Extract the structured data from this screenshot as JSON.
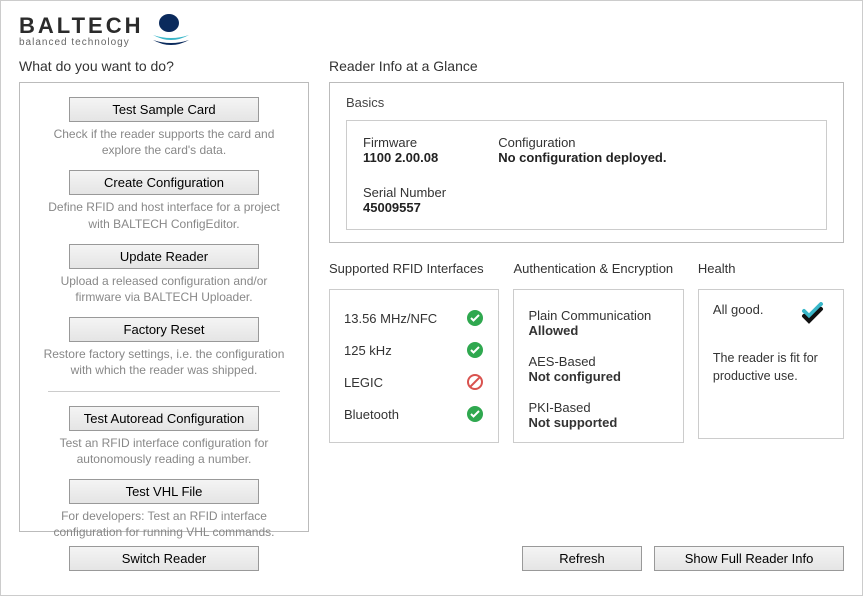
{
  "logo": {
    "brand": "BALTECH",
    "tagline": "balanced technology"
  },
  "left": {
    "heading": "What do you want to do?",
    "actions": [
      {
        "label": "Test Sample Card",
        "desc": "Check if the reader supports the card and explore the card's data."
      },
      {
        "label": "Create Configuration",
        "desc": "Define RFID and host interface for a project with BALTECH ConfigEditor."
      },
      {
        "label": "Update Reader",
        "desc": "Upload a released configuration and/or firmware via BALTECH Uploader."
      },
      {
        "label": "Factory Reset",
        "desc": "Restore factory settings, i.e. the configuration with which the reader was shipped."
      }
    ],
    "actions2": [
      {
        "label": "Test Autoread Configuration",
        "desc": "Test an RFID interface configuration for autonomously reading a number."
      },
      {
        "label": "Test VHL File",
        "desc": "For developers: Test an RFID interface configuration for running VHL commands."
      }
    ],
    "switch_label": "Switch Reader"
  },
  "right": {
    "heading": "Reader Info at a Glance",
    "basics_title": "Basics",
    "basics": {
      "firmware_label": "Firmware",
      "firmware_value": "1100 2.00.08",
      "config_label": "Configuration",
      "config_value": "No configuration deployed.",
      "serial_label": "Serial Number",
      "serial_value": "45009557"
    },
    "rfid_title": "Supported RFID Interfaces",
    "rfid": [
      {
        "name": "13.56 MHz/NFC",
        "status": "ok"
      },
      {
        "name": "125 kHz",
        "status": "ok"
      },
      {
        "name": "LEGIC",
        "status": "no"
      },
      {
        "name": "Bluetooth",
        "status": "ok"
      }
    ],
    "auth_title": "Authentication & Encryption",
    "auth": [
      {
        "name": "Plain Communication",
        "value": "Allowed"
      },
      {
        "name": "AES-Based",
        "value": "Not configured"
      },
      {
        "name": "PKI-Based",
        "value": "Not supported"
      }
    ],
    "health_title": "Health",
    "health_status": "All good.",
    "health_detail": "The reader is fit for productive use.",
    "refresh_label": "Refresh",
    "full_info_label": "Show Full Reader Info"
  }
}
